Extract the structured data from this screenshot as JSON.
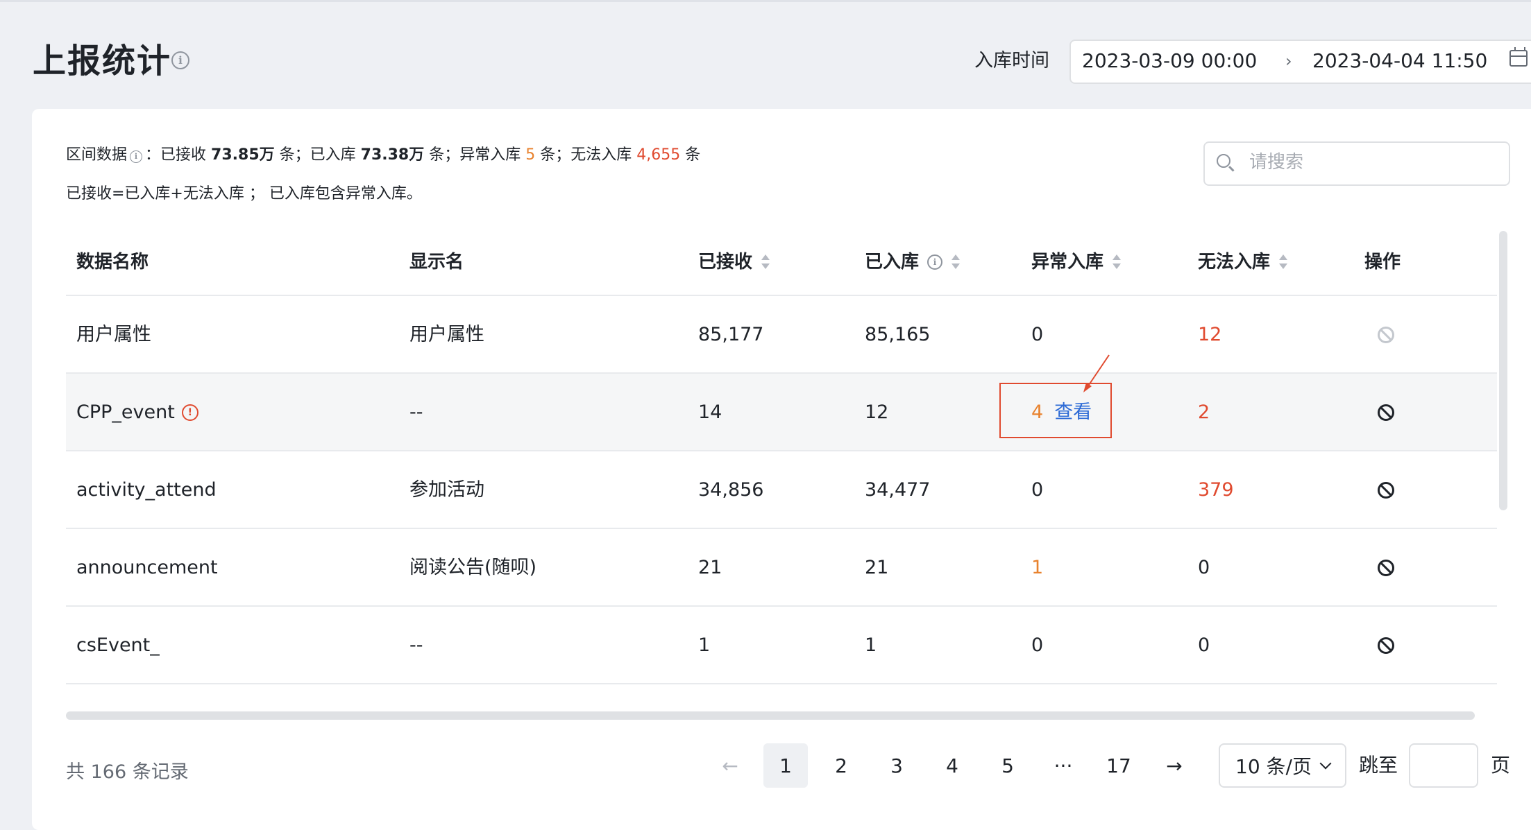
{
  "header": {
    "title": "上报统计",
    "date_label": "入库时间",
    "date_start": "2023-03-09 00:00",
    "date_separator": "›",
    "date_end": "2023-04-04 11:50"
  },
  "summary": {
    "prefix": "区间数据",
    "info_mark": "i",
    "colon": "：",
    "received_label": "已接收",
    "received_value": "73.85万",
    "stored_label": "条；已入库",
    "stored_value": "73.38万",
    "abnormal_label": "条；异常入库",
    "abnormal_value": "5",
    "failed_label": "条；无法入库",
    "failed_value": "4,655",
    "suffix": "条",
    "note": "已接收=已入库+无法入库 ； 已入库包含异常入库。"
  },
  "search": {
    "placeholder": "请搜索"
  },
  "table": {
    "headers": [
      "数据名称",
      "显示名",
      "已接收",
      "已入库",
      "异常入库",
      "无法入库",
      "操作"
    ],
    "rows": [
      {
        "name": "用户属性",
        "display": "用户属性",
        "received": "85,177",
        "stored": "85,165",
        "abnormal": "0",
        "failed": "12"
      },
      {
        "name": "CPP_event",
        "display": "--",
        "received": "14",
        "stored": "12",
        "abnormal": "4",
        "abnormal_action": "查看",
        "failed": "2",
        "warning": "!"
      },
      {
        "name": "activity_attend",
        "display": "参加活动",
        "received": "34,856",
        "stored": "34,477",
        "abnormal": "0",
        "failed": "379"
      },
      {
        "name": "announcement",
        "display": "阅读公告(随呗)",
        "received": "21",
        "stored": "21",
        "abnormal": "1",
        "failed": "0"
      },
      {
        "name": "csEvent_",
        "display": "--",
        "received": "1",
        "stored": "1",
        "abnormal": "0",
        "failed": "0"
      }
    ]
  },
  "pagination": {
    "total_text": "共 166 条记录",
    "prev": "←",
    "pages": [
      "1",
      "2",
      "3",
      "4",
      "5",
      "···",
      "17"
    ],
    "next": "→",
    "page_size": "10 条/页",
    "jump_label": "跳至",
    "jump_value": "",
    "page_unit": "页"
  },
  "colors": {
    "accent": "#2c6ad6",
    "danger": "#e04a2f",
    "warning": "#e8822e"
  }
}
